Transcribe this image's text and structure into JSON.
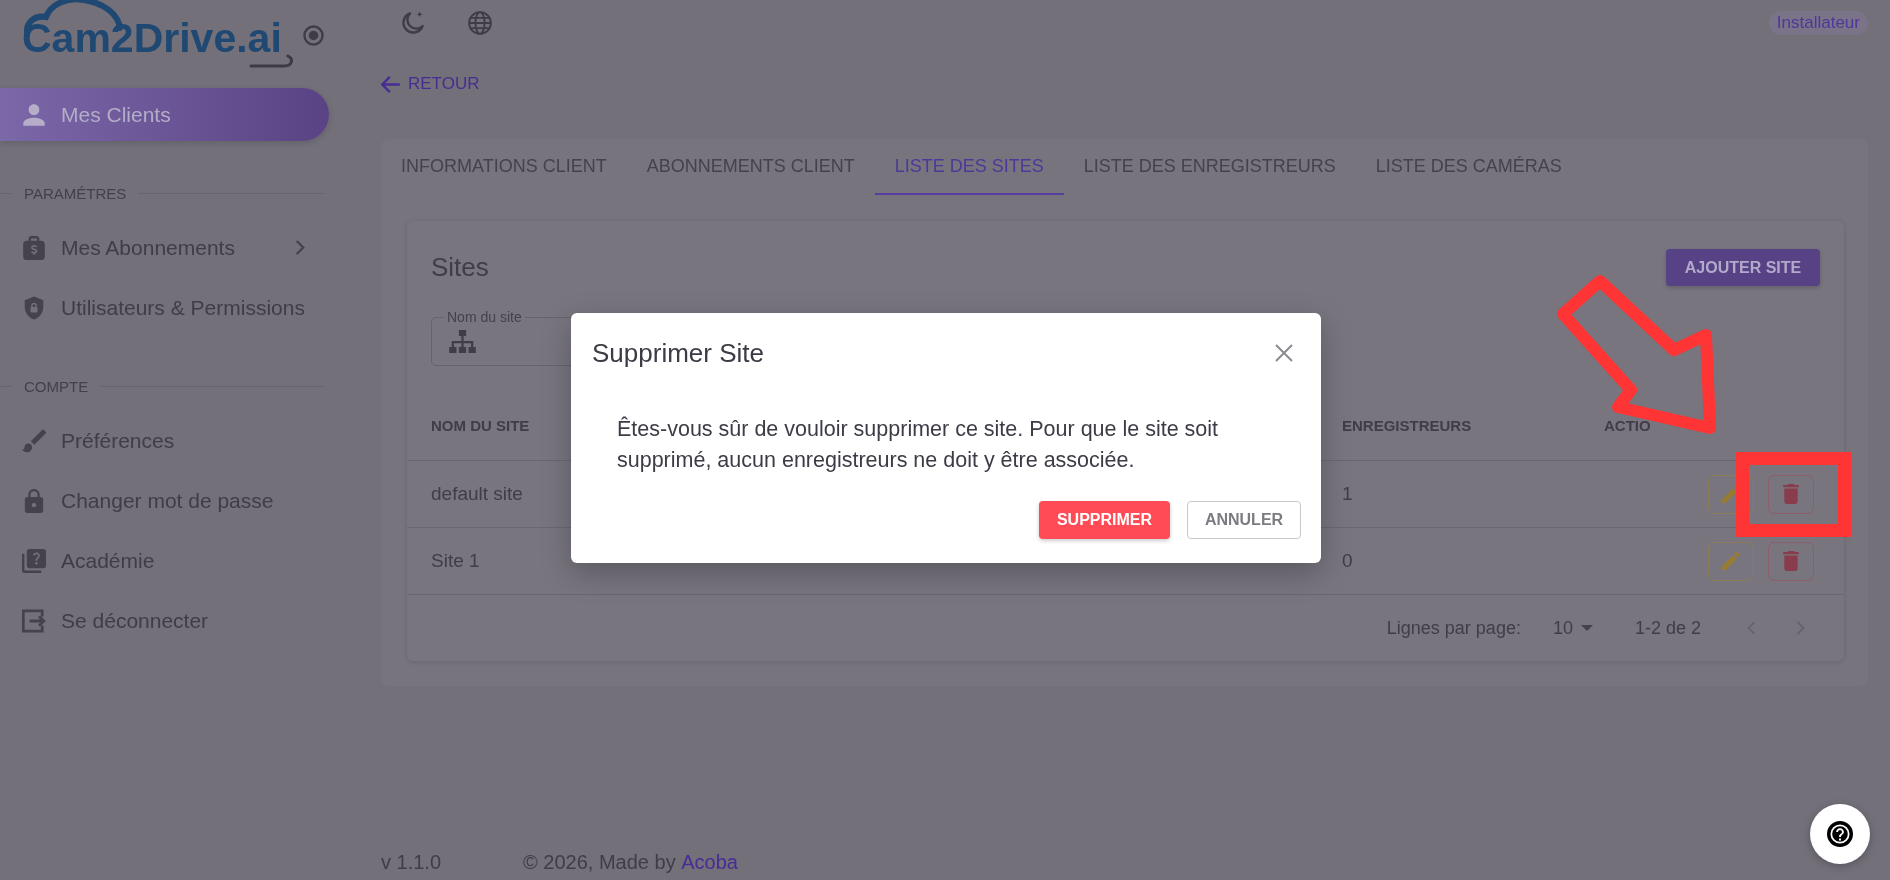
{
  "sidebar": {
    "logo": "Cam2Drive.ai",
    "top_items": [
      {
        "label": "Mes Clients",
        "selected": true,
        "expandable": false
      }
    ],
    "sections": [
      {
        "title": "PARAMÉTRES",
        "items": [
          {
            "label": "Mes Abonnements",
            "selected": false,
            "expandable": true
          },
          {
            "label": "Utilisateurs & Permissions",
            "selected": false,
            "expandable": false
          }
        ]
      },
      {
        "title": "COMPTE",
        "items": [
          {
            "label": "Préférences",
            "selected": false,
            "expandable": false
          },
          {
            "label": "Changer mot de passe",
            "selected": false,
            "expandable": false
          },
          {
            "label": "Académie",
            "selected": false,
            "expandable": false
          },
          {
            "label": "Se déconnecter",
            "selected": false,
            "expandable": false
          }
        ]
      }
    ]
  },
  "top_bar": {
    "role_badge": "Installateur"
  },
  "back_link": "RETOUR",
  "tabs": [
    {
      "label": "INFORMATIONS CLIENT",
      "selected": false
    },
    {
      "label": "ABONNEMENTS CLIENT",
      "selected": false
    },
    {
      "label": "LISTE DES SITES",
      "selected": true
    },
    {
      "label": "LISTE DES ENREGISTREURS",
      "selected": false
    },
    {
      "label": "LISTE DES CAMÉRAS",
      "selected": false
    }
  ],
  "sites": {
    "title": "Sites",
    "add_button": "AJOUTER SITE",
    "filter": {
      "label": "Nom du site"
    },
    "columns": [
      "NOM DU SITE",
      "ENREGISTREURS",
      "ACTIO"
    ],
    "rows": [
      {
        "cells": [
          "default site",
          "1"
        ]
      },
      {
        "cells": [
          "Site 1",
          "0"
        ]
      }
    ],
    "pagination": {
      "rows_per_page_label": "Lignes par page:",
      "rows_per_page": "10",
      "range": "1-2 de 2",
      "prev_disabled": true,
      "next_disabled": true
    }
  },
  "dialog": {
    "title": "Supprimer Site",
    "message": "Êtes-vous sûr de vouloir supprimer ce site. Pour que le site soit supprimé, aucun enregistreurs ne doit y être associée.",
    "confirm_button": "SUPPRIMER",
    "cancel_button": "ANNULER"
  },
  "annotations": [
    {
      "kind": "arrow"
    },
    {
      "kind": "frame"
    }
  ],
  "footer": {
    "version": "v 1.1.0",
    "copyright": "© 2026, Made by",
    "link": "Acoba"
  }
}
